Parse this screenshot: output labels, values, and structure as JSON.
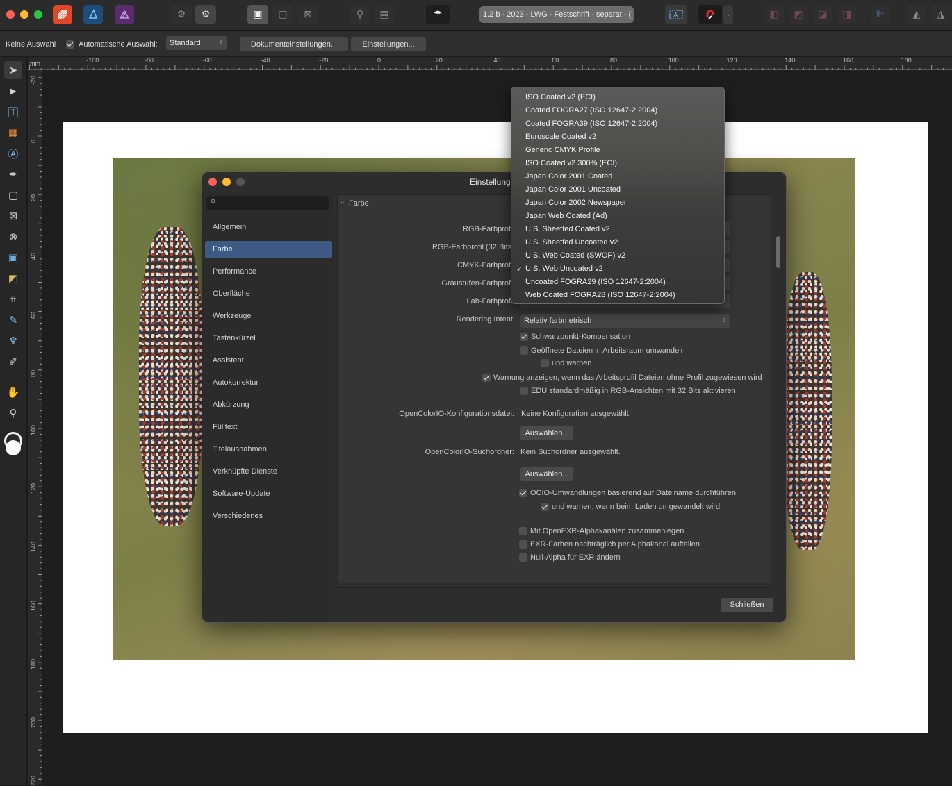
{
  "toolbar": {
    "doc_tab_label": "1.2 b - 2023 - LWG - Festschrift - separat - (",
    "icons": [
      "affinity-publisher-icon",
      "affinity-designer-icon",
      "affinity-photo-icon",
      "persona-settings-icon",
      "persona-develop-icon",
      "view-mode-icon",
      "preview-icon",
      "bleed-icon",
      "pin-icon",
      "frame-icon",
      "preflight-icon",
      "text-frame-icon",
      "snapping-magnet-icon",
      "arrange-icons",
      "align-icons"
    ]
  },
  "context_bar": {
    "selection_status": "Keine Auswahl",
    "auto_select_label": "Automatische Auswahl:",
    "auto_select_value": "Standard",
    "document_settings_button": "Dokumenteinstellungen...",
    "settings_button": "Einstellungen..."
  },
  "rulers": {
    "unit": "mm",
    "h_labels": [
      "-100",
      "-80",
      "-60",
      "-40",
      "-20",
      "0",
      "20",
      "40",
      "60",
      "80",
      "100",
      "120",
      "140",
      "160",
      "180"
    ],
    "v_labels": [
      "-20",
      "0",
      "20",
      "40",
      "60",
      "80",
      "100",
      "120",
      "140",
      "160",
      "180",
      "200",
      "220"
    ]
  },
  "dialog": {
    "title": "Einstellungen",
    "search_placeholder": "",
    "sidebar": [
      "Allgemein",
      "Farbe",
      "Performance",
      "Oberfläche",
      "Werkzeuge",
      "Tastenkürzel",
      "Assistent",
      "Autokorrektur",
      "Abkürzung",
      "Fülltext",
      "Titelausnahmen",
      "Verknüpfte Dienste",
      "Software-Update",
      "Verschiedenes"
    ],
    "selected_section": "Farbe",
    "section_header": "Farbe",
    "labels": {
      "rgb_profile": "RGB-Farbprofil:",
      "rgb32_profile": "RGB-Farbprofil (32 Bits):",
      "cmyk_profile": "CMYK-Farbprofil:",
      "gray_profile": "Graustufen-Farbprofil:",
      "lab_profile": "Lab-Farbprofil:",
      "rendering_intent": "Rendering Intent:",
      "ocio_config": "OpenColorIO-Konfigurationsdatei:",
      "ocio_search": "OpenColorIO-Suchordner:"
    },
    "rendering_intent_value": "Relativ farbmetrisch",
    "ocio_config_value": "Keine Konfiguration ausgewählt.",
    "ocio_search_value": "Kein Suchordner ausgewählt.",
    "choose_button": "Auswählen...",
    "checkboxes": {
      "black_point": "Schwarzpunkt-Kompensation",
      "convert_open": "Geöffnete Dateien in Arbeitsraum umwandeln",
      "and_warn": "und warnen",
      "warn_assign": "Warnung anzeigen, wenn das Arbeitsprofil Dateien ohne Profil zugewiesen wird",
      "edu_default": "EDU standardmäßig in RGB-Ansichten mit 32 Bits aktivieren",
      "ocio_convert": "OCIO-Umwandlungen basierend auf Dateiname durchführen",
      "ocio_warn": "und warnen, wenn beim Laden umgewandelt wird",
      "openexr_merge": "Mit OpenEXR-Alphakanälen zusammenlegen",
      "exr_split": "EXR-Farben nachträglich per Alphakanal aufteilen",
      "null_alpha": "Null-Alpha für EXR ändern"
    },
    "close_button": "Schließen"
  },
  "dropdown": {
    "options": [
      "ISO Coated v2 (ECI)",
      "Coated FOGRA27 (ISO 12647-2:2004)",
      "Coated FOGRA39 (ISO 12647-2:2004)",
      "Euroscale Coated v2",
      "Generic CMYK Profile",
      "ISO Coated v2 300% (ECI)",
      "Japan Color 2001 Coated",
      "Japan Color 2001 Uncoated",
      "Japan Color 2002 Newspaper",
      "Japan Web Coated (Ad)",
      "U.S. Sheetfed Coated v2",
      "U.S. Sheetfed Uncoated v2",
      "U.S. Web Coated (SWOP) v2",
      "U.S. Web Uncoated v2",
      "Uncoated FOGRA29 (ISO 12647-2:2004)",
      "Web Coated FOGRA28 (ISO 12647-2:2004)"
    ],
    "selected": "U.S. Web Uncoated v2"
  },
  "colors": {
    "accent_selection": "#3d5a85",
    "close_red": "#fe5f57",
    "minimize_yellow": "#febc2e",
    "maximize_green": "#28c840"
  }
}
